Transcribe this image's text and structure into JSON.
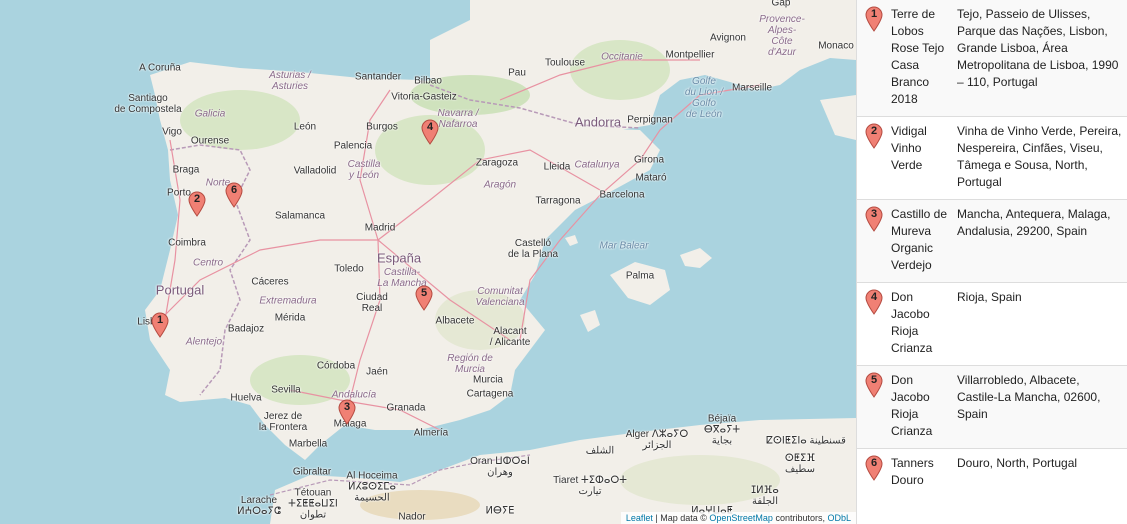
{
  "map": {
    "places": [
      {
        "id": "a-coruna",
        "label": "A Coruña",
        "kind": "city"
      },
      {
        "id": "santiago",
        "label": "Santiago\nde Compostela",
        "kind": "city"
      },
      {
        "id": "vigo",
        "label": "Vigo",
        "kind": "city"
      },
      {
        "id": "ourense",
        "label": "Ourense",
        "kind": "city"
      },
      {
        "id": "galicia",
        "label": "Galicia",
        "kind": "region"
      },
      {
        "id": "asturias",
        "label": "Asturias /\nAsturies",
        "kind": "region"
      },
      {
        "id": "santander",
        "label": "Santander",
        "kind": "city"
      },
      {
        "id": "bilbao",
        "label": "Bilbao",
        "kind": "city"
      },
      {
        "id": "vitoria",
        "label": "Vitoria-Gasteiz",
        "kind": "city"
      },
      {
        "id": "navarra",
        "label": "Navarra /\nNafarroa",
        "kind": "region"
      },
      {
        "id": "pau",
        "label": "Pau",
        "kind": "city"
      },
      {
        "id": "toulouse",
        "label": "Toulouse",
        "kind": "city"
      },
      {
        "id": "occitanie",
        "label": "Occitanie",
        "kind": "region"
      },
      {
        "id": "montpellier",
        "label": "Montpellier",
        "kind": "city"
      },
      {
        "id": "avignon",
        "label": "Avignon",
        "kind": "city"
      },
      {
        "id": "provence",
        "label": "Provence-\nAlpes-\nCôte\nd'Azur",
        "kind": "region"
      },
      {
        "id": "monaco",
        "label": "Monaco",
        "kind": "city"
      },
      {
        "id": "gap",
        "label": "Gap",
        "kind": "city"
      },
      {
        "id": "marseille",
        "label": "Marseille",
        "kind": "city"
      },
      {
        "id": "golfe",
        "label": "Golfe\ndu Lion /\nGolfo\nde León",
        "kind": "sea"
      },
      {
        "id": "andorra",
        "label": "Andorra",
        "kind": "country"
      },
      {
        "id": "perpignan",
        "label": "Perpignan",
        "kind": "city"
      },
      {
        "id": "leon",
        "label": "León",
        "kind": "city"
      },
      {
        "id": "burgos",
        "label": "Burgos",
        "kind": "city"
      },
      {
        "id": "palencia",
        "label": "Palencia",
        "kind": "city"
      },
      {
        "id": "castilla-leon",
        "label": "Castilla\ny León",
        "kind": "region"
      },
      {
        "id": "valladolid",
        "label": "Valladolid",
        "kind": "city"
      },
      {
        "id": "zaragoza",
        "label": "Zaragoza",
        "kind": "city"
      },
      {
        "id": "aragon",
        "label": "Aragón",
        "kind": "region"
      },
      {
        "id": "lleida",
        "label": "Lleida",
        "kind": "city"
      },
      {
        "id": "catalunya",
        "label": "Catalunya",
        "kind": "region"
      },
      {
        "id": "girona",
        "label": "Girona",
        "kind": "city"
      },
      {
        "id": "mataro",
        "label": "Mataró",
        "kind": "city"
      },
      {
        "id": "barcelona",
        "label": "Barcelona",
        "kind": "city"
      },
      {
        "id": "tarragona",
        "label": "Tarragona",
        "kind": "city"
      },
      {
        "id": "braga",
        "label": "Braga",
        "kind": "city"
      },
      {
        "id": "norte",
        "label": "Norte",
        "kind": "region"
      },
      {
        "id": "porto",
        "label": "Porto",
        "kind": "city"
      },
      {
        "id": "salamanca",
        "label": "Salamanca",
        "kind": "city"
      },
      {
        "id": "madrid",
        "label": "Madrid",
        "kind": "city"
      },
      {
        "id": "espana",
        "label": "España",
        "kind": "country"
      },
      {
        "id": "coimbra",
        "label": "Coimbra",
        "kind": "city"
      },
      {
        "id": "centro",
        "label": "Centro",
        "kind": "region"
      },
      {
        "id": "toledo",
        "label": "Toledo",
        "kind": "city"
      },
      {
        "id": "castilla-mancha",
        "label": "Castilla-\nLa Mancha",
        "kind": "region"
      },
      {
        "id": "castello",
        "label": "Castelló\nde la Plana",
        "kind": "city"
      },
      {
        "id": "mar-balear",
        "label": "Mar Balear",
        "kind": "sea"
      },
      {
        "id": "palma",
        "label": "Palma",
        "kind": "city"
      },
      {
        "id": "portugal",
        "label": "Portugal",
        "kind": "country"
      },
      {
        "id": "caceres",
        "label": "Cáceres",
        "kind": "city"
      },
      {
        "id": "extremadura",
        "label": "Extremadura",
        "kind": "region"
      },
      {
        "id": "ciudad-real",
        "label": "Ciudad\nReal",
        "kind": "city"
      },
      {
        "id": "comunitat",
        "label": "Comunitat\nValenciana",
        "kind": "region"
      },
      {
        "id": "lisboa",
        "label": "Lisboa",
        "kind": "city"
      },
      {
        "id": "merida",
        "label": "Mérida",
        "kind": "city"
      },
      {
        "id": "badajoz",
        "label": "Badajoz",
        "kind": "city"
      },
      {
        "id": "albacete",
        "label": "Albacete",
        "kind": "city"
      },
      {
        "id": "alacant",
        "label": "Alacant\n/ Alicante",
        "kind": "city"
      },
      {
        "id": "alentejo",
        "label": "Alentejo",
        "kind": "region"
      },
      {
        "id": "murcia-region",
        "label": "Región de\nMurcia",
        "kind": "region"
      },
      {
        "id": "cordoba",
        "label": "Córdoba",
        "kind": "city"
      },
      {
        "id": "jaen",
        "label": "Jaén",
        "kind": "city"
      },
      {
        "id": "murcia",
        "label": "Murcia",
        "kind": "city"
      },
      {
        "id": "sevilla",
        "label": "Sevilla",
        "kind": "city"
      },
      {
        "id": "andalucia",
        "label": "Andalucía",
        "kind": "region"
      },
      {
        "id": "cartagena",
        "label": "Cartagena",
        "kind": "city"
      },
      {
        "id": "huelva",
        "label": "Huelva",
        "kind": "city"
      },
      {
        "id": "jerez",
        "label": "Jerez de\nla Frontera",
        "kind": "city"
      },
      {
        "id": "granada",
        "label": "Granada",
        "kind": "city"
      },
      {
        "id": "malaga",
        "label": "Málaga",
        "kind": "city"
      },
      {
        "id": "almeria",
        "label": "Almería",
        "kind": "city"
      },
      {
        "id": "marbella",
        "label": "Marbella",
        "kind": "city"
      },
      {
        "id": "gibraltar",
        "label": "Gibraltar",
        "kind": "city"
      },
      {
        "id": "al-hoceima",
        "label": "Al Hoceima\nⵍⵃⵓⵙⵉⵎⴰ\nالحسيمة",
        "kind": "city"
      },
      {
        "id": "tetouan",
        "label": "Tétouan\nⵜⵉⵟⵟⴰⵡⵉⵏ\nتطوان",
        "kind": "city"
      },
      {
        "id": "larache",
        "label": "Larache\nⵍⵄⵔⴰⵢⵛ",
        "kind": "city"
      },
      {
        "id": "nador",
        "label": "Nador",
        "kind": "city"
      },
      {
        "id": "oran",
        "label": "Oran ⵡⵀⵔⴰⵏ\nوهران",
        "kind": "city"
      },
      {
        "id": "chlef",
        "label": "الشلف",
        "kind": "city"
      },
      {
        "id": "tiaret",
        "label": "Tiaret ⵜⵉⵀⴰⵔⵜ\nتيارت",
        "kind": "city"
      },
      {
        "id": "alger",
        "label": "Alger ⴷⵣⴰⵢⵔ\nالجزائر",
        "kind": "city"
      },
      {
        "id": "bejaia",
        "label": "Béjaïa\nⴱⴳⴰⵢⵜ\nبجاية",
        "kind": "city"
      },
      {
        "id": "constantine",
        "label": "ⵇⵙⵏⵟⵉⵏⴰ قسنطينة",
        "kind": "city"
      },
      {
        "id": "setif",
        "label": "ⵙⵟⵉⴼ\nسطيف",
        "kind": "city"
      },
      {
        "id": "laghouat",
        "label": "ⵍⴰⵖⵡⴰⵟ",
        "kind": "city"
      },
      {
        "id": "djelfa",
        "label": "ⵊⵍⴼⴰ\nالجلفة",
        "kind": "city"
      },
      {
        "id": "el-bayadh",
        "label": "ⵍⴱⵢⴹ",
        "kind": "city"
      }
    ],
    "markers": [
      {
        "number": "1"
      },
      {
        "number": "2"
      },
      {
        "number": "3"
      },
      {
        "number": "4"
      },
      {
        "number": "5"
      },
      {
        "number": "6"
      }
    ],
    "attribution": {
      "leaflet": "Leaflet",
      "sep1": " | Map data © ",
      "osm": "OpenStreetMap",
      "mid": " contributors, ",
      "odbl": "ODbL"
    }
  },
  "list": [
    {
      "number": "1",
      "name": "Terre de Lobos Rose Tejo Casa Branco 2018",
      "address": "Tejo, Passeio de Ulisses, Parque das Nações, Lisbon, Grande Lisboa, Área Metropolitana de Lisboa, 1990 – 110, Portugal"
    },
    {
      "number": "2",
      "name": "Vidigal Vinho Verde",
      "address": "Vinha de Vinho Verde, Pereira, Nespereira, Cinfães, Viseu, Tâmega e Sousa, North, Portugal"
    },
    {
      "number": "3",
      "name": "Castillo de Mureva Organic Verdejo",
      "address": "Mancha, Antequera, Malaga, Andalusia, 29200, Spain"
    },
    {
      "number": "4",
      "name": "Don Jacobo Rioja Crianza",
      "address": "Rioja, Spain"
    },
    {
      "number": "5",
      "name": "Don Jacobo Rioja Crianza",
      "address": "Villarrobledo, Albacete, Castile-La Mancha, 02600, Spain"
    },
    {
      "number": "6",
      "name": "Tanners Douro",
      "address": "Douro, North, Portugal"
    }
  ],
  "colors": {
    "marker": "#f08074",
    "land": "#f2efe9",
    "sea": "#aad3df",
    "forest": "#cfe2bd",
    "border": "#b89ab8"
  }
}
